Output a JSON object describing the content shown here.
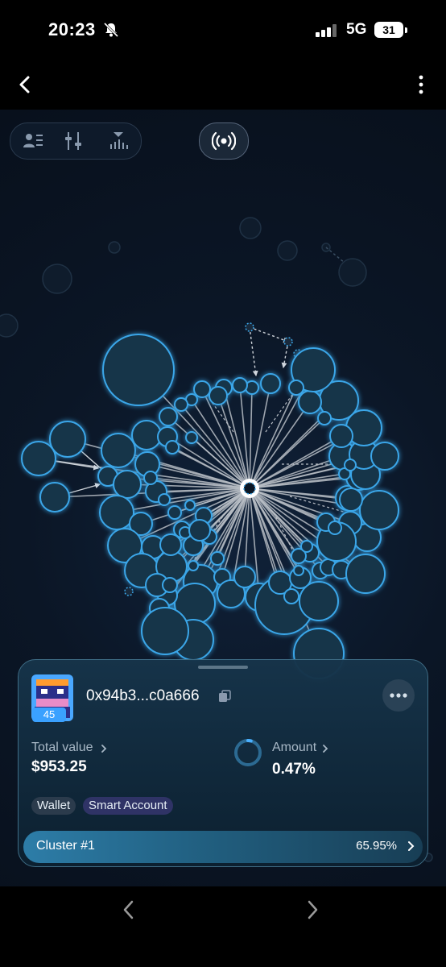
{
  "status_bar": {
    "time": "20:23",
    "network": "5G",
    "battery": "31"
  },
  "header": {
    "back_icon": "chevron-left-icon",
    "menu_icon": "vertical-dots-icon"
  },
  "toolbar": {
    "icons": [
      "wallet-list-icon",
      "filter-sliders-icon",
      "distribution-icon"
    ],
    "live_icon": "broadcast-icon"
  },
  "card": {
    "address": "0x94b3...c0a666",
    "avatar_badge": "45",
    "total_value_label": "Total value",
    "total_value": "$953.25",
    "amount_label": "Amount",
    "amount": "0.47%",
    "amount_fraction": 0.0047,
    "tags": [
      "Wallet",
      "Smart Account"
    ],
    "cluster_label": "Cluster #1",
    "cluster_pct": "65.95%",
    "accent": "#3aa1ff",
    "node_stroke": "#3aa6e8",
    "node_fill": "#16344a"
  }
}
